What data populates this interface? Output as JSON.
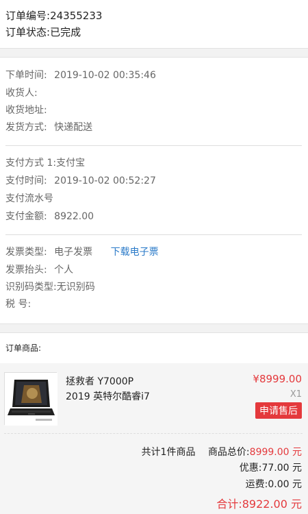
{
  "order": {
    "number_label": "订单编号:",
    "number": "24355233",
    "status_label": "订单状态:",
    "status": "已完成"
  },
  "shipping": {
    "order_time_label": "下单时间:",
    "order_time": "2019-10-02 00:35:46",
    "receiver_label": "收货人:",
    "address_label": "收货地址:",
    "delivery_label": "发货方式:",
    "delivery": "快递配送"
  },
  "payment": {
    "method_label": "支付方式 1:",
    "method": "支付宝",
    "time_label": "支付时间:",
    "time": "2019-10-02 00:52:27",
    "serial_label": "支付流水号",
    "amount_label": "支付金额:",
    "amount": "8922.00"
  },
  "invoice": {
    "type_label": "发票类型:",
    "type": "电子发票",
    "download_link": "下载电子票",
    "header_label": "发票抬头:",
    "header": "个人",
    "id_type_label": "识别码类型:",
    "id_type": "无识别码",
    "tax_label": "税 号:"
  },
  "goods": {
    "title": "订单商品:",
    "product_name_line1": "拯救者 Y7000P",
    "product_name_line2": "2019 英特尔酷睿i7",
    "price": "¥8999.00",
    "qty": "X1",
    "after_sale_button": "申请售后",
    "count_text": "共计1件商品",
    "goods_total_label": "商品总价:",
    "goods_total": "8999.00 元",
    "discount_label": "优惠:",
    "discount": "77.00 元",
    "shipping_fee_label": "运费:",
    "shipping_fee": "0.00 元",
    "grand_total_label": "合计:",
    "grand_total": "8922.00 元"
  }
}
